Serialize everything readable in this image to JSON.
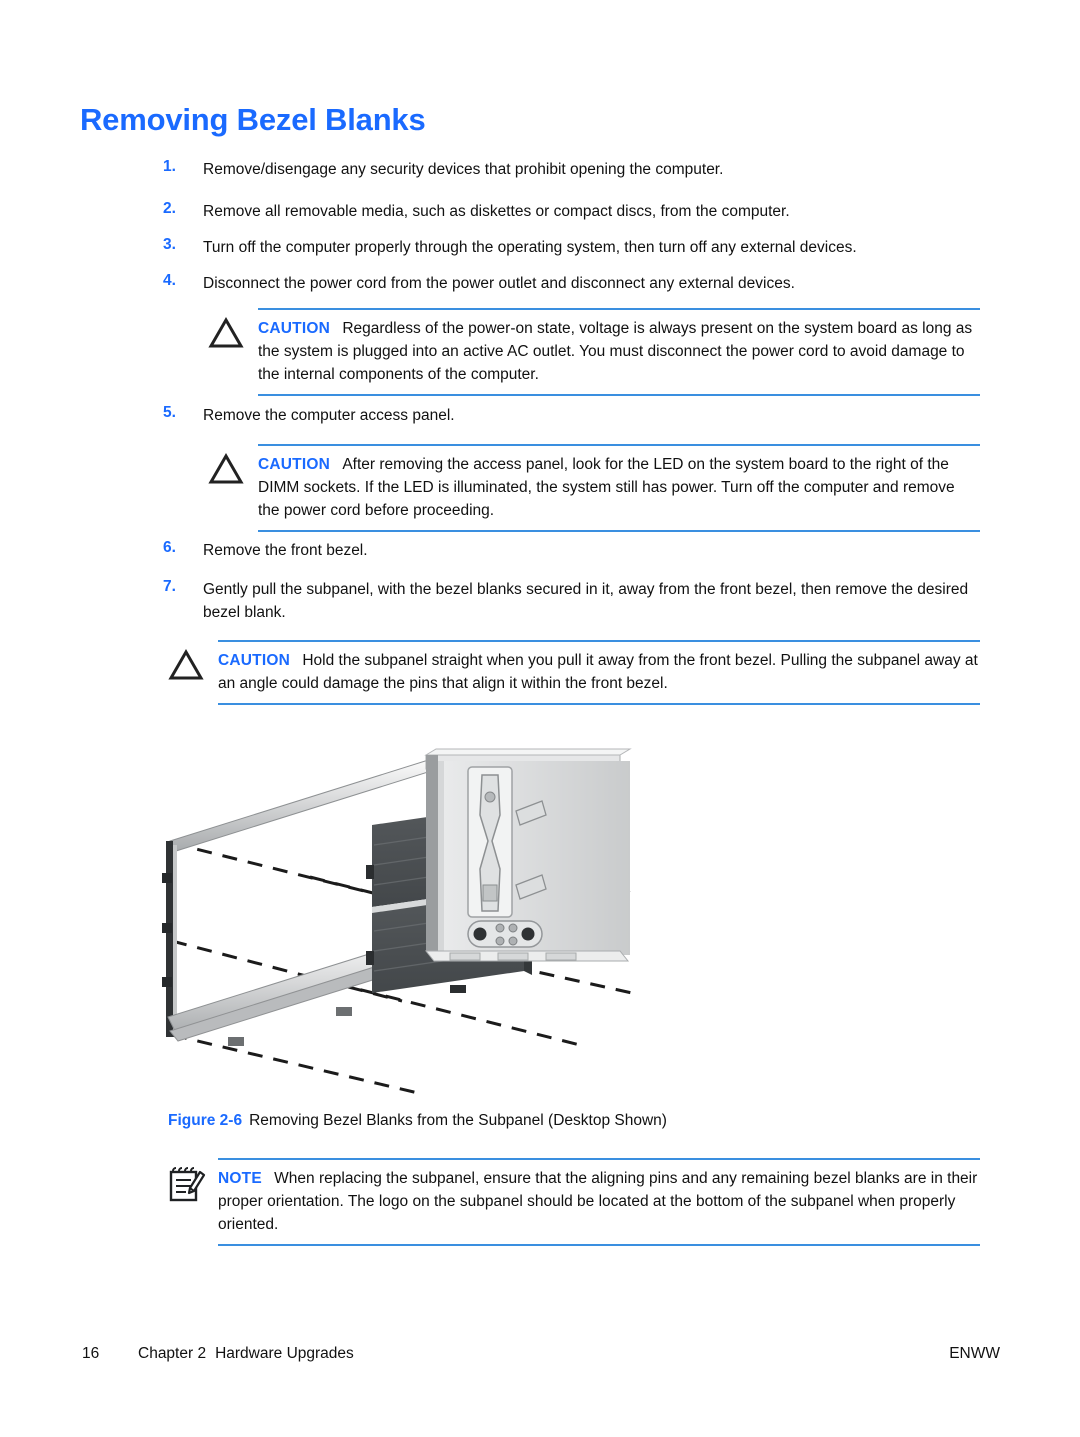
{
  "heading": "Removing Bezel Blanks",
  "colors": {
    "accent_blue": "#1a6aff",
    "rule_blue": "#3a8fe0",
    "bezel_blank_gray": "#4a4f52",
    "text_black": "#111111"
  },
  "steps": [
    {
      "num": "1.",
      "text": "Remove/disengage any security devices that prohibit opening the computer."
    },
    {
      "num": "2.",
      "text": "Remove all removable media, such as diskettes or compact discs, from the computer."
    },
    {
      "num": "3.",
      "text": "Turn off the computer properly through the operating system, then turn off any external devices."
    },
    {
      "num": "4.",
      "text": "Disconnect the power cord from the power outlet and disconnect any external devices."
    },
    {
      "num": "5.",
      "text": "Remove the computer access panel."
    },
    {
      "num": "6.",
      "text": "Remove the front bezel."
    },
    {
      "num": "7.",
      "text": "Gently pull the subpanel, with the bezel blanks secured in it, away from the front bezel, then remove the desired bezel blank."
    }
  ],
  "admonitions": [
    {
      "label": "CAUTION",
      "icon": "warning-triangle-icon",
      "text": "Regardless of the power-on state, voltage is always present on the system board as long as the system is plugged into an active AC outlet. You must disconnect the power cord to avoid damage to the internal components of the computer."
    },
    {
      "label": "CAUTION",
      "icon": "warning-triangle-icon",
      "text": "After removing the access panel, look for the LED on the system board to the right of the DIMM sockets. If the LED is illuminated, the system still has power. Turn off the computer and remove the power cord before proceeding."
    },
    {
      "label": "CAUTION",
      "icon": "warning-triangle-icon",
      "text": "Hold the subpanel straight when you pull it away from the front bezel. Pulling the subpanel away at an angle could damage the pins that align it within the front bezel."
    },
    {
      "label": "NOTE",
      "icon": "note-pad-pencil-icon",
      "text": "When replacing the subpanel, ensure that the aligning pins and any remaining bezel blanks are in their proper orientation. The logo on the subpanel should be located at the bottom of the subpanel when properly oriented."
    }
  ],
  "figure": {
    "number": "Figure 2-6",
    "caption": "Removing Bezel Blanks from the Subpanel (Desktop Shown)",
    "alt": "Exploded view: subpanel frame on the left, two dark bezel blanks in the middle, computer chassis front on the right, joined by dashed alignment lines"
  },
  "footer": {
    "page_number": "16",
    "chapter_label": "Chapter 2",
    "chapter_title": "Hardware Upgrades",
    "imprint": "ENWW"
  }
}
